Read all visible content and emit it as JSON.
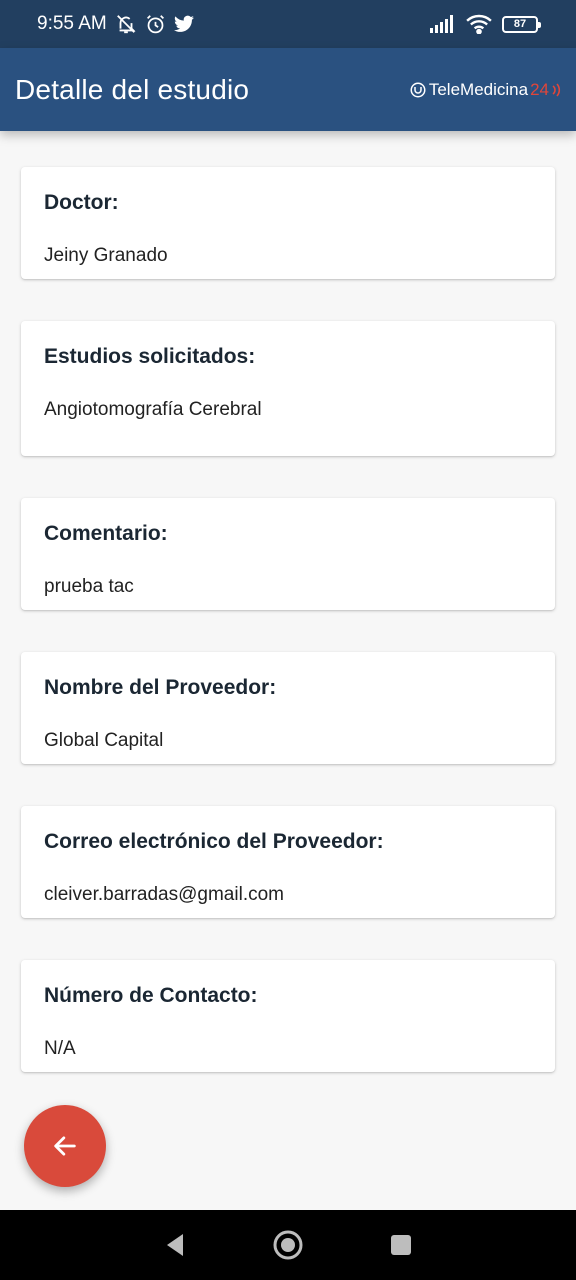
{
  "status_bar": {
    "time": "9:55 AM",
    "battery": "87",
    "icons": [
      "mute-icon",
      "alarm-icon",
      "twitter-icon",
      "signal-icon",
      "wifi-icon",
      "battery-icon"
    ]
  },
  "app_bar": {
    "title": "Detalle del estudio",
    "logo_text": "TeleMedicina",
    "logo_number": "24"
  },
  "cards": [
    {
      "label": "Doctor:",
      "value": "Jeiny Granado"
    },
    {
      "label": "Estudios solicitados:",
      "value": "Angiotomografía Cerebral"
    },
    {
      "label": "Comentario:",
      "value": "prueba tac"
    },
    {
      "label": "Nombre del Proveedor:",
      "value": "Global Capital"
    },
    {
      "label": "Correo electrónico del Proveedor:",
      "value": "cleiver.barradas@gmail.com"
    },
    {
      "label": "Número de Contacto:",
      "value": "N/A"
    }
  ],
  "fab": {
    "icon": "arrow-left-icon"
  },
  "colors": {
    "status_bar": "#223f60",
    "app_bar": "#2a5180",
    "fab": "#d94a3b",
    "logo_accent": "#e0463a",
    "background": "#f7f7f7"
  }
}
